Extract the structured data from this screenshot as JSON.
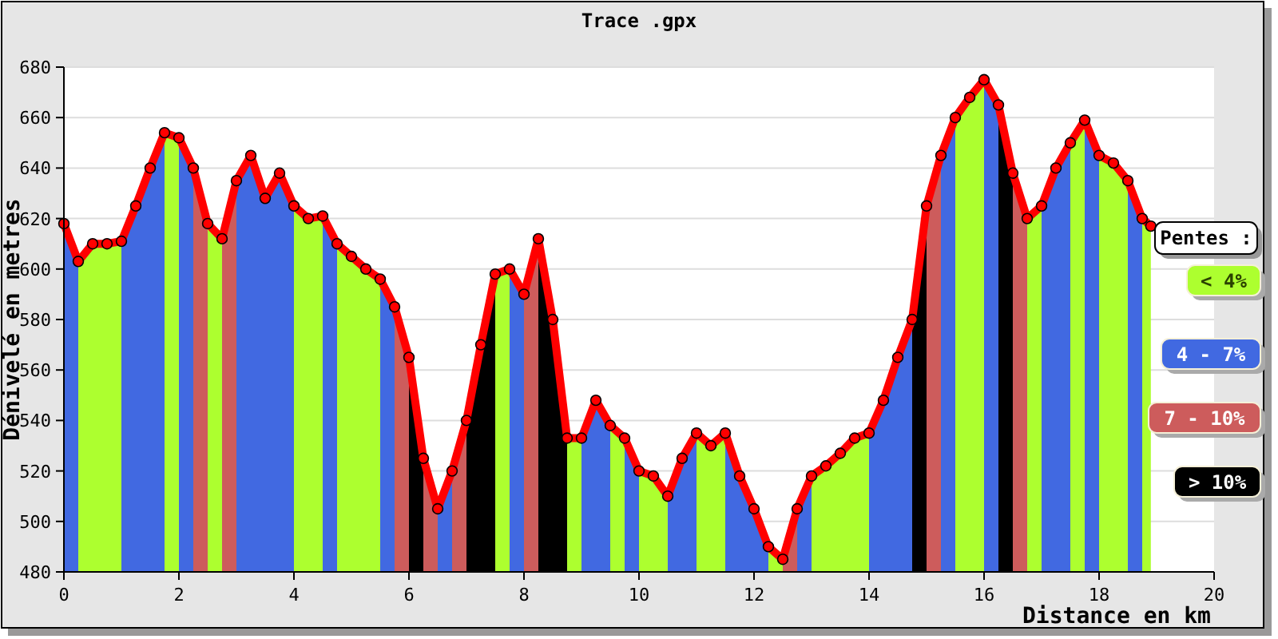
{
  "chart": {
    "chart_data": {
      "type": "area",
      "title": "Trace .gpx",
      "xlabel": "Distance en km",
      "ylabel": "Dénivelé en metres",
      "x": [
        0,
        0.25,
        0.25,
        0.5,
        0.75,
        1,
        1,
        1.25,
        1.5,
        1.75,
        1.75,
        2,
        2,
        2.25,
        2.25,
        2.5,
        2.5,
        2.75,
        2.75,
        3,
        3,
        3.25,
        3.5,
        3.75,
        4,
        4,
        4.25,
        4.5,
        4.5,
        4.75,
        4.75,
        5,
        5.25,
        5.5,
        5.5,
        5.75,
        5.75,
        6,
        6,
        6.25,
        6.25,
        6.5,
        6.5,
        6.75,
        6.75,
        7,
        7,
        7.25,
        7.5,
        7.5,
        7.75,
        7.75,
        8,
        8,
        8.25,
        8.25,
        8.5,
        8.75,
        8.75,
        9,
        9,
        9.25,
        9.5,
        9.5,
        9.75,
        9.75,
        10,
        10,
        10.25,
        10.5,
        10.5,
        10.75,
        11,
        11,
        11.25,
        11.5,
        11.5,
        11.75,
        12,
        12.25,
        12.25,
        12.5,
        12.5,
        12.75,
        12.75,
        13,
        13,
        13.25,
        13.5,
        13.75,
        14,
        14,
        14.25,
        14.5,
        14.75,
        14.75,
        15,
        15,
        15.25,
        15.25,
        15.5,
        15.5,
        15.75,
        16,
        16,
        16.25,
        16.25,
        16.5,
        16.5,
        16.75,
        16.75,
        17,
        17,
        17.25,
        17.5,
        17.5,
        17.75,
        17.75,
        18,
        18,
        18.25,
        18.5,
        18.5,
        18.75,
        18.75,
        18.9
      ],
      "grid": true,
      "series": [
        {
          "type": "area",
          "name": "< 4%",
          "color": "#adff2f",
          "values": [
            null,
            null,
            603,
            610,
            610,
            611,
            null,
            null,
            null,
            null,
            654,
            652,
            null,
            null,
            null,
            null,
            618,
            612,
            null,
            null,
            null,
            null,
            null,
            null,
            null,
            625,
            620,
            621,
            null,
            null,
            610,
            605,
            600,
            596,
            null,
            null,
            null,
            null,
            null,
            null,
            null,
            null,
            null,
            null,
            null,
            null,
            null,
            null,
            null,
            598,
            600,
            null,
            null,
            null,
            null,
            null,
            null,
            null,
            533,
            533,
            null,
            null,
            null,
            538,
            533,
            null,
            null,
            520,
            518,
            510,
            null,
            null,
            null,
            535,
            530,
            535,
            null,
            null,
            null,
            null,
            490,
            485,
            null,
            null,
            null,
            null,
            518,
            522,
            527,
            533,
            535,
            null,
            null,
            null,
            null,
            null,
            null,
            null,
            null,
            null,
            null,
            660,
            668,
            675,
            null,
            null,
            null,
            null,
            null,
            null,
            620,
            625,
            null,
            null,
            null,
            650,
            659,
            null,
            null,
            645,
            642,
            635,
            null,
            null,
            620,
            617
          ]
        },
        {
          "type": "area",
          "name": "4 - 7%",
          "color": "#4169e1",
          "values": [
            618,
            603,
            null,
            null,
            null,
            null,
            611,
            625,
            640,
            654,
            null,
            null,
            652,
            640,
            null,
            null,
            null,
            null,
            null,
            null,
            635,
            645,
            628,
            638,
            625,
            null,
            null,
            null,
            621,
            610,
            null,
            null,
            null,
            null,
            596,
            585,
            null,
            null,
            null,
            null,
            null,
            null,
            505,
            520,
            null,
            null,
            null,
            null,
            null,
            null,
            null,
            600,
            590,
            null,
            null,
            null,
            null,
            null,
            null,
            null,
            533,
            548,
            538,
            null,
            null,
            533,
            520,
            null,
            null,
            null,
            510,
            525,
            535,
            null,
            null,
            null,
            535,
            518,
            505,
            490,
            null,
            null,
            null,
            null,
            505,
            518,
            null,
            null,
            null,
            null,
            null,
            535,
            548,
            565,
            580,
            null,
            null,
            null,
            null,
            645,
            660,
            null,
            null,
            null,
            675,
            665,
            null,
            null,
            null,
            null,
            null,
            null,
            625,
            640,
            650,
            null,
            null,
            659,
            645,
            null,
            null,
            null,
            635,
            620,
            null,
            null
          ]
        },
        {
          "type": "area",
          "name": "7 - 10%",
          "color": "#cd5c5c",
          "values": [
            null,
            null,
            null,
            null,
            null,
            null,
            null,
            null,
            null,
            null,
            null,
            null,
            null,
            null,
            640,
            618,
            null,
            null,
            612,
            635,
            null,
            null,
            null,
            null,
            null,
            null,
            null,
            null,
            null,
            null,
            null,
            null,
            null,
            null,
            null,
            null,
            585,
            565,
            null,
            null,
            525,
            505,
            null,
            null,
            520,
            540,
            null,
            null,
            null,
            null,
            null,
            null,
            null,
            590,
            612,
            null,
            null,
            null,
            null,
            null,
            null,
            null,
            null,
            null,
            null,
            null,
            null,
            null,
            null,
            null,
            null,
            null,
            null,
            null,
            null,
            null,
            null,
            null,
            null,
            null,
            null,
            null,
            485,
            505,
            null,
            null,
            null,
            null,
            null,
            null,
            null,
            null,
            null,
            null,
            null,
            null,
            null,
            625,
            645,
            null,
            null,
            null,
            null,
            null,
            null,
            null,
            null,
            null,
            638,
            620,
            null,
            null,
            null,
            null,
            null,
            null,
            null,
            null,
            null,
            null,
            null,
            null,
            null,
            null,
            null,
            null
          ]
        },
        {
          "type": "area",
          "name": "> 10%",
          "color": "#000000",
          "values": [
            null,
            null,
            null,
            null,
            null,
            null,
            null,
            null,
            null,
            null,
            null,
            null,
            null,
            null,
            null,
            null,
            null,
            null,
            null,
            null,
            null,
            null,
            null,
            null,
            null,
            null,
            null,
            null,
            null,
            null,
            null,
            null,
            null,
            null,
            null,
            null,
            null,
            null,
            565,
            525,
            null,
            null,
            null,
            null,
            null,
            null,
            540,
            570,
            598,
            null,
            null,
            null,
            null,
            null,
            null,
            612,
            580,
            533,
            null,
            null,
            null,
            null,
            null,
            null,
            null,
            null,
            null,
            null,
            null,
            null,
            null,
            null,
            null,
            null,
            null,
            null,
            null,
            null,
            null,
            null,
            null,
            null,
            null,
            null,
            null,
            null,
            null,
            null,
            null,
            null,
            null,
            null,
            null,
            null,
            null,
            580,
            625,
            null,
            null,
            null,
            null,
            null,
            null,
            null,
            null,
            null,
            665,
            638,
            null,
            null,
            null,
            null,
            null,
            null,
            null,
            null,
            null,
            null,
            null,
            null,
            null,
            null,
            null,
            null,
            null,
            null
          ]
        },
        {
          "type": "line",
          "color": "#ff0000",
          "values": [
            618,
            603,
            603,
            610,
            610,
            611,
            611,
            625,
            640,
            654,
            654,
            652,
            652,
            640,
            640,
            618,
            618,
            612,
            612,
            635,
            635,
            645,
            628,
            638,
            625,
            625,
            620,
            621,
            621,
            610,
            610,
            605,
            600,
            596,
            596,
            585,
            585,
            565,
            565,
            525,
            525,
            505,
            505,
            520,
            520,
            540,
            540,
            570,
            598,
            598,
            600,
            600,
            590,
            590,
            612,
            612,
            580,
            533,
            533,
            533,
            533,
            548,
            538,
            538,
            533,
            533,
            520,
            520,
            518,
            510,
            510,
            525,
            535,
            535,
            530,
            535,
            535,
            518,
            505,
            490,
            490,
            485,
            485,
            505,
            505,
            518,
            518,
            522,
            527,
            533,
            535,
            535,
            548,
            565,
            580,
            580,
            625,
            625,
            645,
            645,
            660,
            660,
            668,
            675,
            675,
            665,
            665,
            638,
            638,
            620,
            620,
            625,
            625,
            640,
            650,
            650,
            659,
            659,
            645,
            645,
            642,
            635,
            635,
            620,
            620,
            617
          ]
        }
      ],
      "xlim": [
        0,
        20
      ],
      "ylim": [
        480,
        680
      ],
      "xticks": [
        0,
        2,
        4,
        6,
        8,
        10,
        12,
        14,
        16,
        18,
        20
      ],
      "yticks": [
        480,
        500,
        520,
        540,
        560,
        580,
        600,
        620,
        640,
        660,
        680
      ]
    },
    "legend_title": "Pentes :"
  }
}
